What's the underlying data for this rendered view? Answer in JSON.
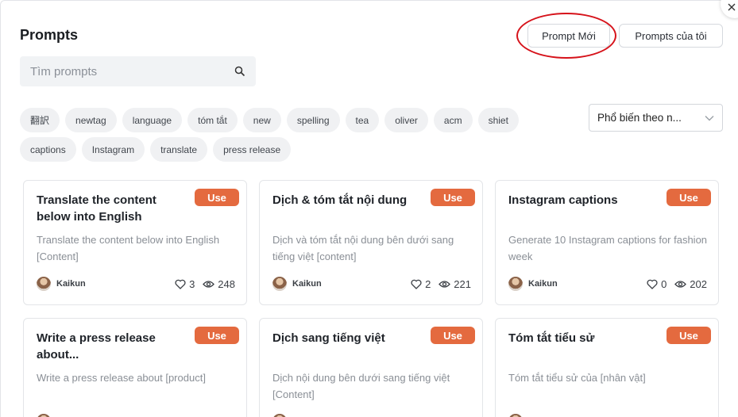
{
  "header": {
    "title": "Prompts",
    "new_prompt_label": "Prompt Mới",
    "my_prompts_label": "Prompts của tôi"
  },
  "search": {
    "placeholder": "Tìm prompts",
    "value": ""
  },
  "tags_row1": [
    "翻訳",
    "newtag",
    "language",
    "tóm tắt",
    "new",
    "spelling",
    "tea",
    "oliver",
    "acm",
    "shiet"
  ],
  "tags_row2": [
    "captions",
    "Instagram",
    "translate",
    "press release"
  ],
  "sort": {
    "selected": "Phổ biến theo n..."
  },
  "use_label": "Use",
  "cards": [
    {
      "title": "Translate the content below into English",
      "desc": "Translate the content below into English [Content]",
      "author": "Kaikun",
      "likes": "3",
      "views": "248"
    },
    {
      "title": "Dịch & tóm tắt nội dung",
      "desc": "Dịch và tóm tắt nội dung bên dưới sang tiếng việt [content]",
      "author": "Kaikun",
      "likes": "2",
      "views": "221"
    },
    {
      "title": "Instagram captions",
      "desc": "Generate 10 Instagram captions for fashion week",
      "author": "Kaikun",
      "likes": "0",
      "views": "202"
    },
    {
      "title": "Write a press release about...",
      "desc": "Write a press release about [product]"
    },
    {
      "title": "Dịch sang tiếng việt",
      "desc": "Dịch nội dung bên dưới sang tiếng việt [Content]"
    },
    {
      "title": "Tóm tắt tiểu sử",
      "desc": "Tóm tắt tiểu sử của [nhân vật]"
    }
  ],
  "colors": {
    "use_button": "#e46a3f",
    "annotation_ring": "#d6121a"
  }
}
